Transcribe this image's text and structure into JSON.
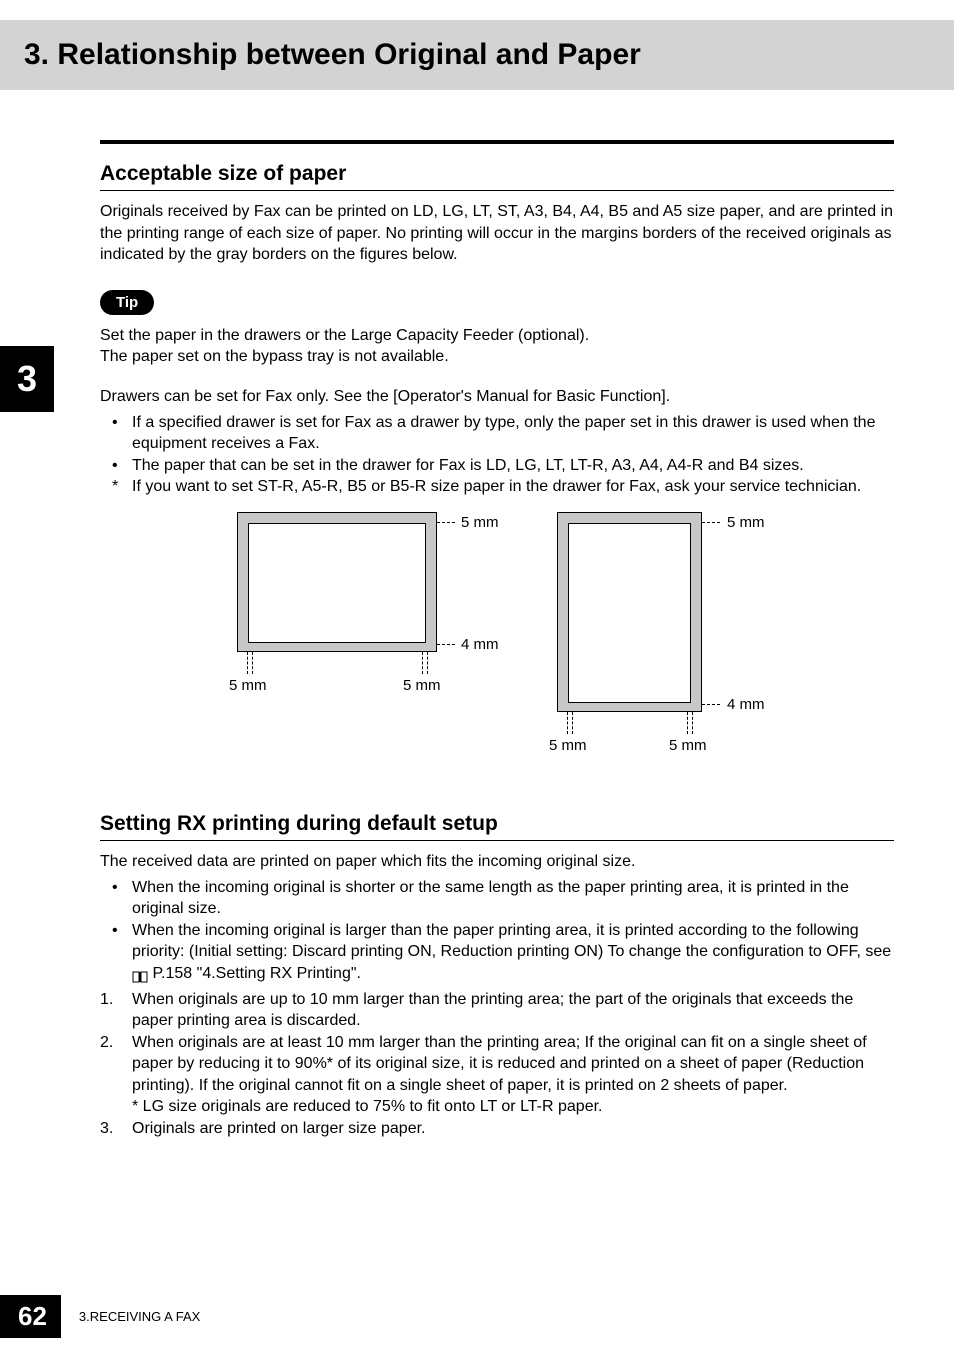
{
  "title": "3. Relationship between Original and Paper",
  "chapter_tab": "3",
  "section1": {
    "heading": "Acceptable size of paper",
    "intro": "Originals received by Fax can be printed on LD, LG, LT, ST, A3, B4, A4, B5 and A5 size paper, and are printed in the printing range of each size of paper. No printing will occur in the margins borders of the received originals as indicated by the gray borders on the figures below.",
    "tip_label": "Tip",
    "tip_line1": "Set the paper in the drawers or the Large Capacity Feeder (optional).",
    "tip_line2": "The paper set on the bypass tray is not available.",
    "note_intro": "Drawers can be set for Fax only. See the [Operator's Manual for Basic Function].",
    "bullets": [
      "If a specified drawer is set for Fax as a drawer by type, only the paper set in this drawer is used when the equipment receives a Fax.",
      "The paper that can be set in the drawer for Fax is LD, LG, LT, LT-R, A3, A4, A4-R and B4 sizes."
    ],
    "star_note": "If you want to set ST-R, A5-R, B5 or B5-R size paper in the drawer for Fax, ask your service technician."
  },
  "diagram_labels": {
    "top": "5 mm",
    "bottom": "4 mm",
    "left": "5 mm",
    "right": "5 mm"
  },
  "section2": {
    "heading": "Setting RX printing during default setup",
    "intro": "The received data are printed on paper which fits the incoming original size.",
    "bullets": [
      "When the incoming original is shorter or the same length as the paper printing area, it is printed in the original size.",
      "When the incoming original is larger than the paper printing area, it is printed according to the following priority: (Initial setting: Discard printing ON, Reduction printing ON) To change the configuration to OFF, see "
    ],
    "ref_text": " P.158 \"4.Setting RX Printing\".",
    "numbered": [
      "When originals are up to 10 mm larger than the printing area; the part of the originals that exceeds the paper printing area is discarded.",
      "When originals are at least 10 mm larger than the printing area; If the original can fit on a single sheet of paper by reducing it to 90%* of its original size, it is reduced and printed on a sheet of paper (Reduction printing). If the original cannot fit on a single sheet of paper, it is printed on 2 sheets of paper.\n* LG size originals are reduced to 75% to fit onto LT or LT-R paper.",
      "Originals are printed on larger size paper."
    ]
  },
  "footer": {
    "page": "62",
    "text": "3.RECEIVING A FAX"
  }
}
